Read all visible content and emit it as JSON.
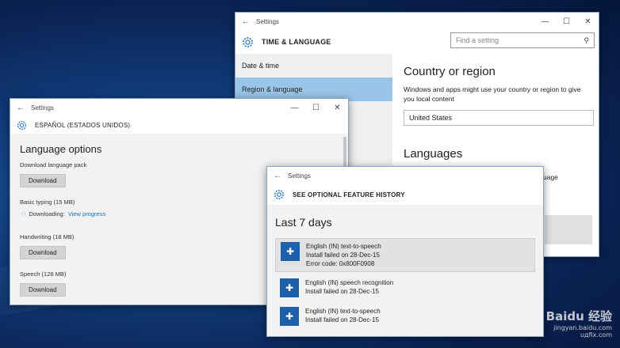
{
  "time_window": {
    "title": "Settings",
    "header": "TIME & LANGUAGE",
    "search_placeholder": "Find a setting",
    "nav": [
      "Date & time",
      "Region & language"
    ],
    "section_title": "Country or region",
    "description": "Windows and apps might use your country or region to give you local content",
    "country_value": "United States",
    "languages_title": "Languages",
    "language_fragment": "uage"
  },
  "es_window": {
    "title": "Settings",
    "header": "ESPAÑOL (ESTADOS UNIDOS)",
    "section_title": "Language options",
    "download_pack_label": "Download language pack",
    "download_label": "Download",
    "basic_typing_label": "Basic typing (15 MB)",
    "downloading_label": "Downloading:",
    "view_progress_label": "View progress",
    "handwriting_label": "Handwriting (18 MB)",
    "speech_label": "Speech (128 MB)"
  },
  "feat_window": {
    "title": "Settings",
    "header": "SEE OPTIONAL FEATURE HISTORY",
    "section_title": "Last 7 days",
    "items": [
      {
        "name": "English (IN) text-to-speech",
        "status": "Install failed on 28-Dec-15",
        "error": "Error code: 0x800F0908"
      },
      {
        "name": "English (IN) speech recognition",
        "status": "Install failed on 28-Dec-15"
      },
      {
        "name": "English (IN) text-to-speech",
        "status": "Install failed on 28-Dec-15"
      }
    ]
  },
  "watermark": {
    "brand": "Baidu 经验",
    "url": "jingyan.baidu.com"
  },
  "watermark2": "uдfix.com",
  "icons": {
    "gear": "gear-icon",
    "back": "back-arrow-icon",
    "search": "search-icon",
    "puzzle": "puzzle-piece-icon"
  }
}
